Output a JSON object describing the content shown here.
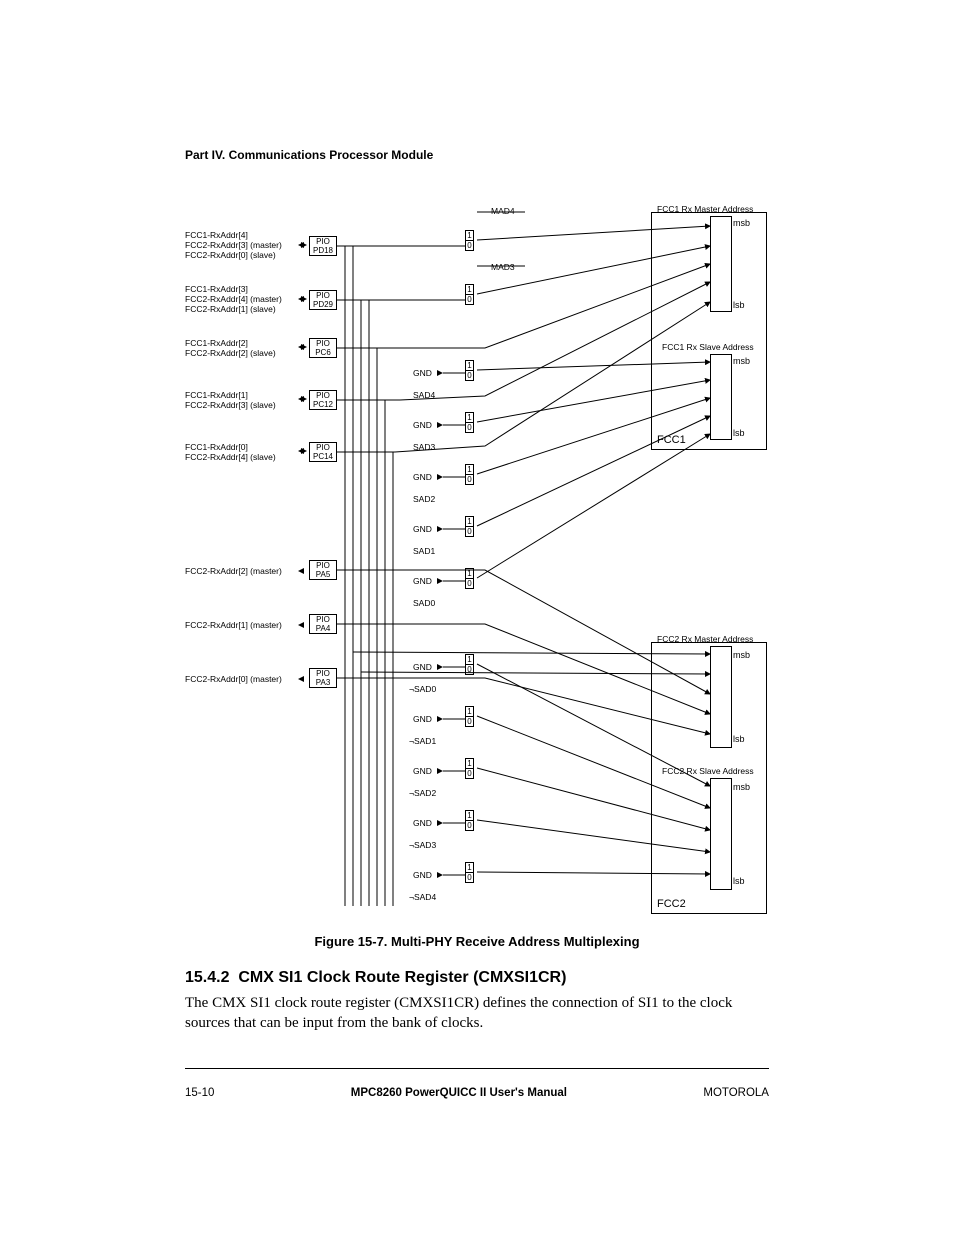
{
  "header": {
    "part": "Part IV.  Communications Processor Module"
  },
  "diagram": {
    "left_groups": [
      {
        "lines": [
          "FCC1-RxAddr[4]",
          "FCC2-RxAddr[3] (master)",
          "FCC2-RxAddr[0] (slave)"
        ],
        "pio": [
          "PIO",
          "PD18"
        ]
      },
      {
        "lines": [
          "FCC1-RxAddr[3]",
          "FCC2-RxAddr[4] (master)",
          "FCC2-RxAddr[1] (slave)"
        ],
        "pio": [
          "PIO",
          "PD29"
        ]
      },
      {
        "lines": [
          "FCC1-RxAddr[2]",
          "FCC2-RxAddr[2] (slave)"
        ],
        "pio": [
          "PIO",
          "PC6"
        ]
      },
      {
        "lines": [
          "FCC1-RxAddr[1]",
          "FCC2-RxAddr[3] (slave)"
        ],
        "pio": [
          "PIO",
          "PC12"
        ]
      },
      {
        "lines": [
          "FCC1-RxAddr[0]",
          "FCC2-RxAddr[4] (slave)"
        ],
        "pio": [
          "PIO",
          "PC14"
        ]
      },
      {
        "lines": [
          "FCC2-RxAddr[2] (master)"
        ],
        "pio": [
          "PIO",
          "PA5"
        ]
      },
      {
        "lines": [
          "FCC2-RxAddr[1] (master)"
        ],
        "pio": [
          "PIO",
          "PA4"
        ]
      },
      {
        "lines": [
          "FCC2-RxAddr[0] (master)"
        ],
        "pio": [
          "PIO",
          "PA3"
        ]
      }
    ],
    "mux_top_signals": [
      "MAD4",
      "MAD3"
    ],
    "mux_mid_signals": [
      {
        "top": "GND",
        "bot": "SAD4"
      },
      {
        "top": "GND",
        "bot": "SAD3"
      },
      {
        "top": "GND",
        "bot": "SAD2"
      },
      {
        "top": "GND",
        "bot": "SAD1"
      },
      {
        "top": "GND",
        "bot": "SAD0"
      }
    ],
    "mux_bot_signals": [
      {
        "top": "GND",
        "bot": "¬SAD0"
      },
      {
        "top": "GND",
        "bot": "¬SAD1"
      },
      {
        "top": "GND",
        "bot": "¬SAD2"
      },
      {
        "top": "GND",
        "bot": "¬SAD3"
      },
      {
        "top": "GND",
        "bot": "¬SAD4"
      }
    ],
    "fcc1": {
      "label": "FCC1",
      "master_box": "FCC1 Rx Master Address",
      "slave_box": "FCC1 Rx Slave Address",
      "msb": "msb",
      "lsb": "lsb"
    },
    "fcc2": {
      "label": "FCC2",
      "master_box": "FCC2 Rx Master Address",
      "slave_box": "FCC2 Rx Slave Address",
      "msb": "msb",
      "lsb": "lsb"
    },
    "mux_digits": {
      "one": "1",
      "zero": "0"
    }
  },
  "figure_caption": "Figure 15-7. Multi-PHY Receive Address Multiplexing",
  "section": {
    "number": "15.4.2",
    "title": "CMX SI1 Clock Route Register (CMXSI1CR)",
    "body": "The CMX SI1 clock route register (CMXSI1CR) defines the connection of SI1 to the clock sources that can be input from the bank of clocks."
  },
  "footer": {
    "left": "15-10",
    "center": "MPC8260 PowerQUICC II User's Manual",
    "right": "MOTOROLA"
  }
}
